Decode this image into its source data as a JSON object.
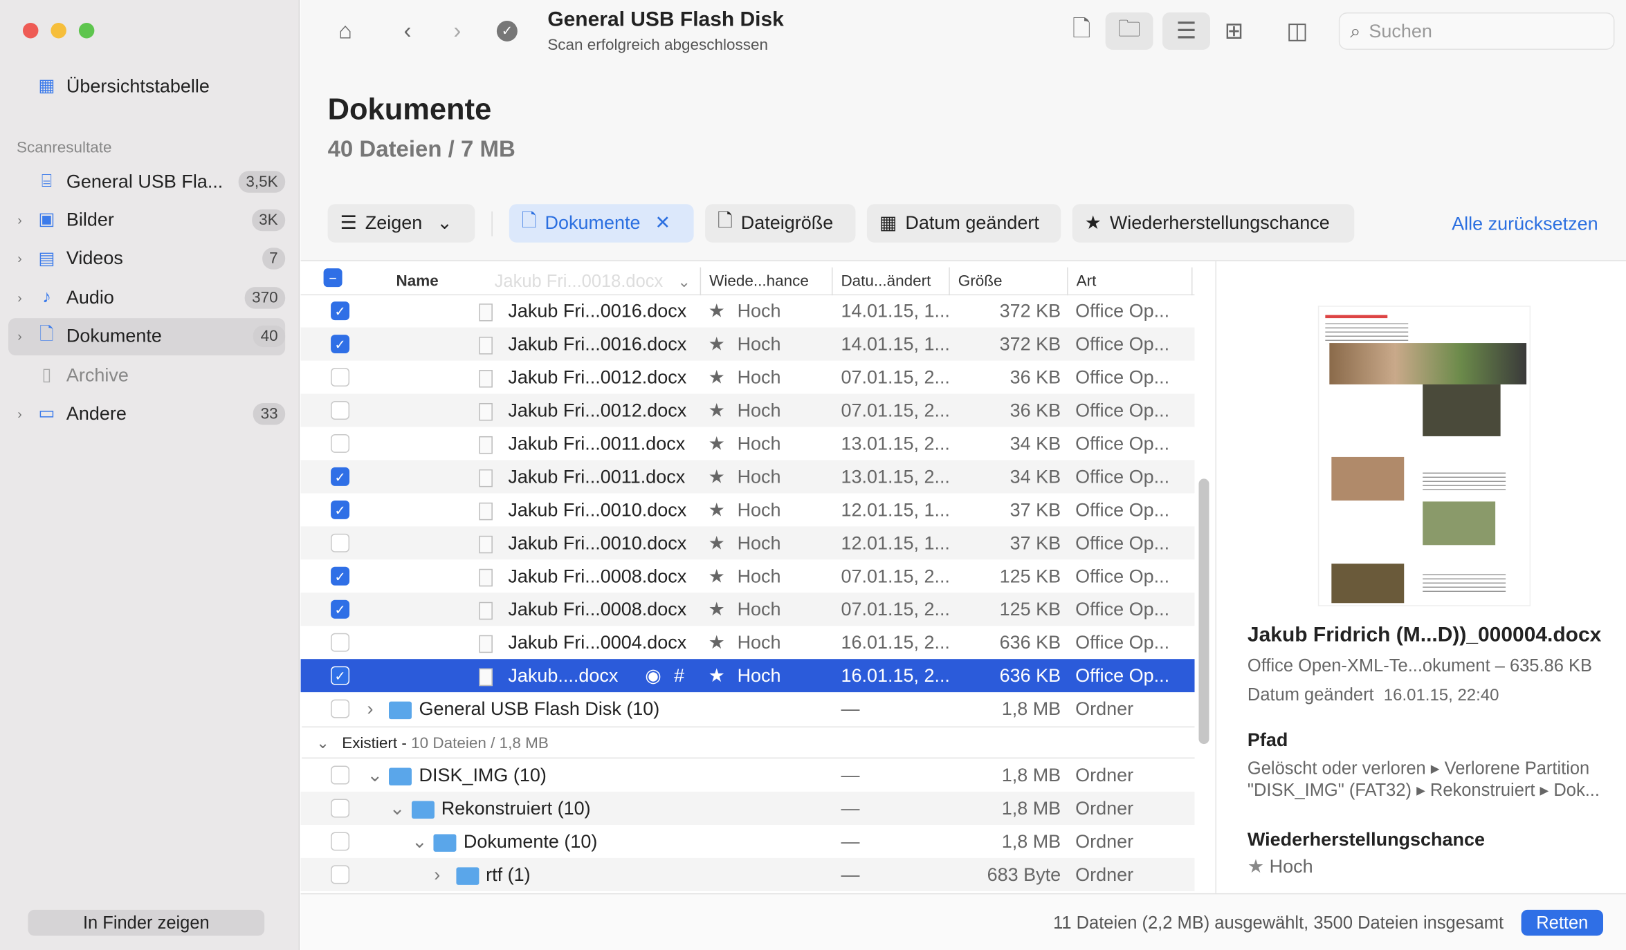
{
  "window": {
    "title": "General USB Flash Disk",
    "subtitle": "Scan erfolgreich abgeschlossen",
    "search_placeholder": "Suchen"
  },
  "sidebar": {
    "overview": "Übersichtstabelle",
    "section": "Scanresultate",
    "items": [
      {
        "label": "General USB Fla...",
        "count": "3,5K",
        "icon": "drive-icon",
        "expand": false
      },
      {
        "label": "Bilder",
        "count": "3K",
        "icon": "image-icon",
        "expand": true
      },
      {
        "label": "Videos",
        "count": "7",
        "icon": "film-icon",
        "expand": true
      },
      {
        "label": "Audio",
        "count": "370",
        "icon": "music-icon",
        "expand": true
      },
      {
        "label": "Dokumente",
        "count": "40",
        "icon": "document-icon",
        "expand": true,
        "selected": true
      },
      {
        "label": "Archive",
        "count": "",
        "icon": "archive-icon",
        "expand": false
      },
      {
        "label": "Andere",
        "count": "33",
        "icon": "file-icon",
        "expand": true
      }
    ],
    "finder_button": "In Finder zeigen"
  },
  "main": {
    "title": "Dokumente",
    "summary": "40 Dateien / 7 MB",
    "filters": {
      "show": "Zeigen",
      "documents": "Dokumente",
      "size": "Dateigröße",
      "date": "Datum geändert",
      "chance": "Wiederherstellungschance",
      "reset": "Alle zurücksetzen"
    },
    "columns": {
      "name": "Name",
      "ghost": "Jakub Fri...0018.docx",
      "chance": "Wiede...hance",
      "date": "Datu...ändert",
      "size": "Größe",
      "type": "Art"
    },
    "rows": [
      {
        "checked": true,
        "name": "Jakub Fri...0016.docx",
        "chance": "Hoch",
        "date": "14.01.15, 1...",
        "size": "372 KB",
        "type": "Office Op..."
      },
      {
        "checked": true,
        "name": "Jakub Fri...0016.docx",
        "chance": "Hoch",
        "date": "14.01.15, 1...",
        "size": "372 KB",
        "type": "Office Op..."
      },
      {
        "checked": false,
        "name": "Jakub Fri...0012.docx",
        "chance": "Hoch",
        "date": "07.01.15, 2...",
        "size": "36 KB",
        "type": "Office Op..."
      },
      {
        "checked": false,
        "name": "Jakub Fri...0012.docx",
        "chance": "Hoch",
        "date": "07.01.15, 2...",
        "size": "36 KB",
        "type": "Office Op..."
      },
      {
        "checked": false,
        "name": "Jakub Fri...0011.docx",
        "chance": "Hoch",
        "date": "13.01.15, 2...",
        "size": "34 KB",
        "type": "Office Op..."
      },
      {
        "checked": true,
        "name": "Jakub Fri...0011.docx",
        "chance": "Hoch",
        "date": "13.01.15, 2...",
        "size": "34 KB",
        "type": "Office Op..."
      },
      {
        "checked": true,
        "name": "Jakub Fri...0010.docx",
        "chance": "Hoch",
        "date": "12.01.15, 1...",
        "size": "37 KB",
        "type": "Office Op..."
      },
      {
        "checked": false,
        "name": "Jakub Fri...0010.docx",
        "chance": "Hoch",
        "date": "12.01.15, 1...",
        "size": "37 KB",
        "type": "Office Op..."
      },
      {
        "checked": true,
        "name": "Jakub Fri...0008.docx",
        "chance": "Hoch",
        "date": "07.01.15, 2...",
        "size": "125 KB",
        "type": "Office Op..."
      },
      {
        "checked": true,
        "name": "Jakub Fri...0008.docx",
        "chance": "Hoch",
        "date": "07.01.15, 2...",
        "size": "125 KB",
        "type": "Office Op..."
      },
      {
        "checked": false,
        "name": "Jakub Fri...0004.docx",
        "chance": "Hoch",
        "date": "16.01.15, 2...",
        "size": "636 KB",
        "type": "Office Op..."
      },
      {
        "checked": true,
        "selected": true,
        "name": "Jakub....docx",
        "chance": "Hoch",
        "date": "16.01.15, 2...",
        "size": "636 KB",
        "type": "Office Op..."
      }
    ],
    "folder_row": {
      "name": "General USB Flash Disk (10)",
      "date": "—",
      "size": "1,8 MB",
      "type": "Ordner"
    },
    "section": {
      "label": "Existiert -",
      "detail": "10 Dateien / 1,8 MB"
    },
    "tree": [
      {
        "name": "DISK_IMG (10)",
        "date": "—",
        "size": "1,8 MB",
        "type": "Ordner",
        "level": 0,
        "open": true
      },
      {
        "name": "Rekonstruiert (10)",
        "date": "—",
        "size": "1,8 MB",
        "type": "Ordner",
        "level": 1,
        "open": true
      },
      {
        "name": "Dokumente (10)",
        "date": "—",
        "size": "1,8 MB",
        "type": "Ordner",
        "level": 2,
        "open": true
      },
      {
        "name": "rtf (1)",
        "date": "—",
        "size": "683 Byte",
        "type": "Ordner",
        "level": 3,
        "open": false
      }
    ]
  },
  "preview": {
    "filename": "Jakub Fridrich (M...D))_000004.docx",
    "kind": "Office Open-XML-Te...okument – 635.86 KB",
    "date_label": "Datum geändert",
    "date": "16.01.15, 22:40",
    "path_label": "Pfad",
    "path": "Gelöscht oder verloren ▸ Verlorene Partition \"DISK_IMG\" (FAT32) ▸ Rekonstruiert ▸ Dok...",
    "chance_label": "Wiederherstellungschance",
    "chance": "Hoch"
  },
  "footer": {
    "status": "11 Dateien (2,2 MB) ausgewählt, 3500 Dateien insgesamt",
    "recover": "Retten"
  },
  "colors": {
    "accent": "#2b5bda",
    "link": "#2b6fe0"
  }
}
